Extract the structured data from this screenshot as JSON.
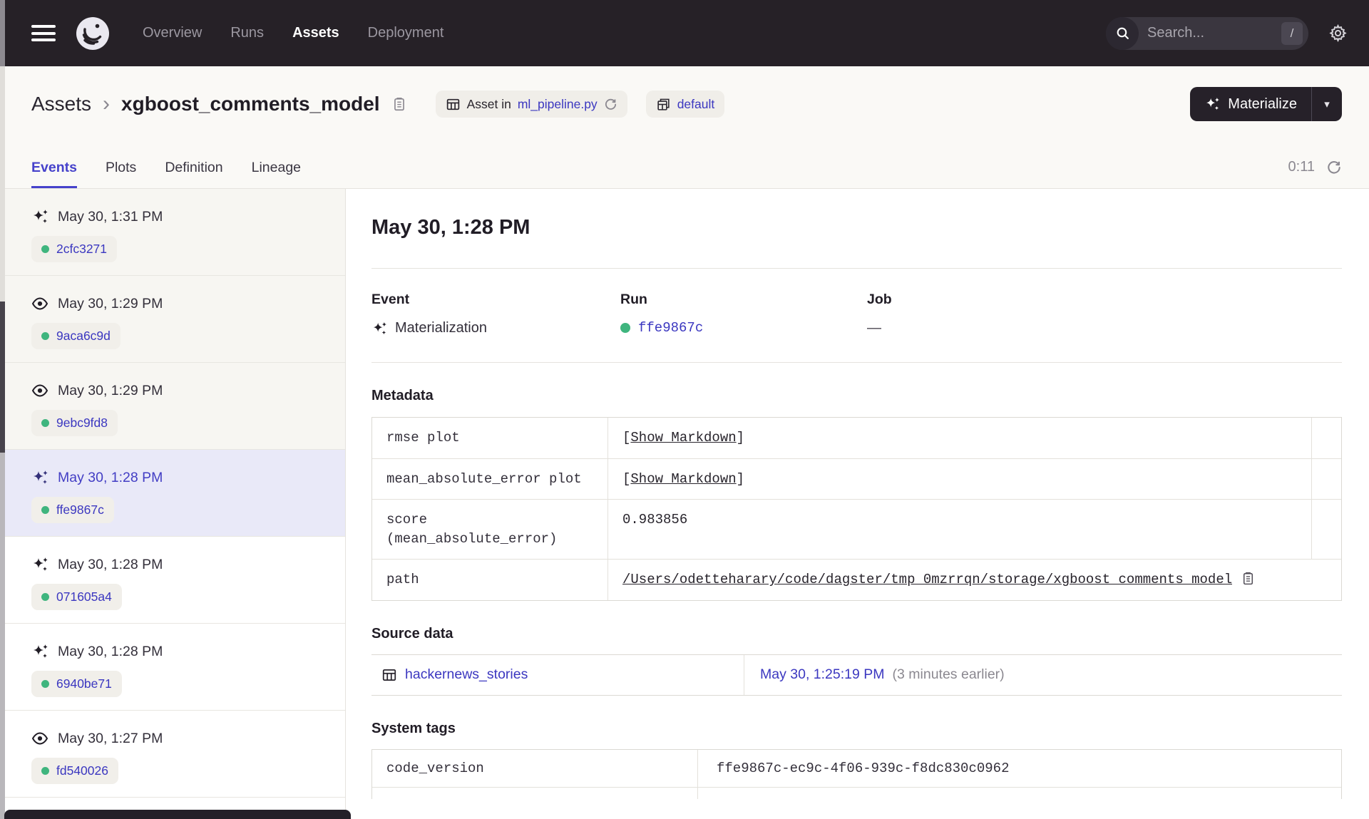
{
  "colors": {
    "accent": "#4642CB",
    "link": "#3B37C0",
    "success_green": "#3FB57E",
    "navbar_bg": "#262127",
    "selected_row_bg": "#E9E9F8"
  },
  "nav": {
    "links": [
      {
        "label": "Overview"
      },
      {
        "label": "Runs"
      },
      {
        "label": "Assets"
      },
      {
        "label": "Deployment"
      }
    ],
    "active_link": "Assets",
    "search": {
      "placeholder": "Search...",
      "shortcut": "/"
    }
  },
  "header": {
    "breadcrumb_root": "Assets",
    "breadcrumb_separator": "›",
    "asset_name": "xgboost_comments_model",
    "location_badge": {
      "prefix": "Asset in",
      "file": "ml_pipeline.py"
    },
    "group_badge": "default",
    "materialize": {
      "label": "Materialize",
      "caret": "▾"
    }
  },
  "tabs": {
    "items": [
      {
        "label": "Events"
      },
      {
        "label": "Plots"
      },
      {
        "label": "Definition"
      },
      {
        "label": "Lineage"
      }
    ],
    "active": "Events",
    "timer": "0:11"
  },
  "sidebar": {
    "events": [
      {
        "type": "materialization",
        "time": "May 30, 1:31 PM",
        "run_id": "2cfc3271"
      },
      {
        "type": "observation",
        "time": "May 30, 1:29 PM",
        "run_id": "9aca6c9d"
      },
      {
        "type": "observation",
        "time": "May 30, 1:29 PM",
        "run_id": "9ebc9fd8"
      },
      {
        "type": "materialization",
        "time": "May 30, 1:28 PM",
        "run_id": "ffe9867c",
        "selected": true
      },
      {
        "type": "materialization",
        "time": "May 30, 1:28 PM",
        "run_id": "071605a4"
      },
      {
        "type": "materialization",
        "time": "May 30, 1:28 PM",
        "run_id": "6940be71"
      },
      {
        "type": "observation",
        "time": "May 30, 1:27 PM",
        "run_id": "fd540026"
      }
    ]
  },
  "detail": {
    "title": "May 30, 1:28 PM",
    "summary": {
      "event_label": "Event",
      "event_value": "Materialization",
      "run_label": "Run",
      "run_value": "ffe9867c",
      "job_label": "Job",
      "job_value": "—"
    },
    "metadata": {
      "heading": "Metadata",
      "rows": [
        {
          "key": "rmse plot",
          "link_prefix": "[",
          "link": "Show Markdown",
          "link_suffix": "]"
        },
        {
          "key": "mean_absolute_error plot",
          "link_prefix": "[",
          "link": "Show Markdown",
          "link_suffix": "]"
        },
        {
          "key_line1": "score",
          "key_line2": "(mean_absolute_error)",
          "value": "0.983856"
        },
        {
          "key": "path",
          "value": "/Users/odetteharary/code/dagster/tmp_0mzrrqn/storage/xgboost_comments_model"
        }
      ]
    },
    "source_data": {
      "heading": "Source data",
      "asset": "hackernews_stories",
      "timestamp": "May 30, 1:25:19 PM",
      "relative": "(3 minutes earlier)"
    },
    "system_tags": {
      "heading": "System tags",
      "rows": [
        {
          "key": "code_version",
          "value": "ffe9867c-ec9c-4f06-939c-f8dc830c0962"
        }
      ]
    }
  }
}
